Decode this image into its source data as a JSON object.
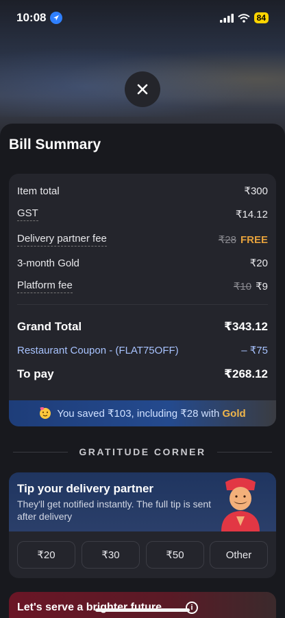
{
  "status_bar": {
    "time": "10:08",
    "battery": "84"
  },
  "bill_summary": {
    "title": "Bill Summary",
    "rows": [
      {
        "label": "Item total",
        "value": "₹300"
      },
      {
        "label": "GST",
        "value": "₹14.12"
      },
      {
        "label": "Delivery partner fee",
        "original": "₹28",
        "value": "FREE"
      },
      {
        "label": "3-month Gold",
        "value": "₹20"
      },
      {
        "label": "Platform fee",
        "original": "₹10",
        "value": "₹9"
      }
    ],
    "grand_total": {
      "label": "Grand Total",
      "value": "₹343.12"
    },
    "coupon": {
      "label": "Restaurant Coupon - (FLAT75OFF)",
      "value": "– ₹75"
    },
    "to_pay": {
      "label": "To pay",
      "value": "₹268.12"
    },
    "savings": {
      "prefix": "You saved ₹103, including ₹28 with",
      "gold_word": "Gold"
    }
  },
  "gratitude": {
    "heading": "GRATITUDE CORNER",
    "tip_title": "Tip your delivery partner",
    "tip_subtitle": "They'll get notified instantly. The full tip is sent after delivery",
    "tip_options": [
      "₹20",
      "₹30",
      "₹50",
      "Other"
    ]
  },
  "brighter_future": {
    "text": "Let's serve a brighter future"
  },
  "colors": {
    "accent_gold": "#f0b64a",
    "free_orange": "#e6a23c",
    "savings_blue": "#244a8e"
  }
}
